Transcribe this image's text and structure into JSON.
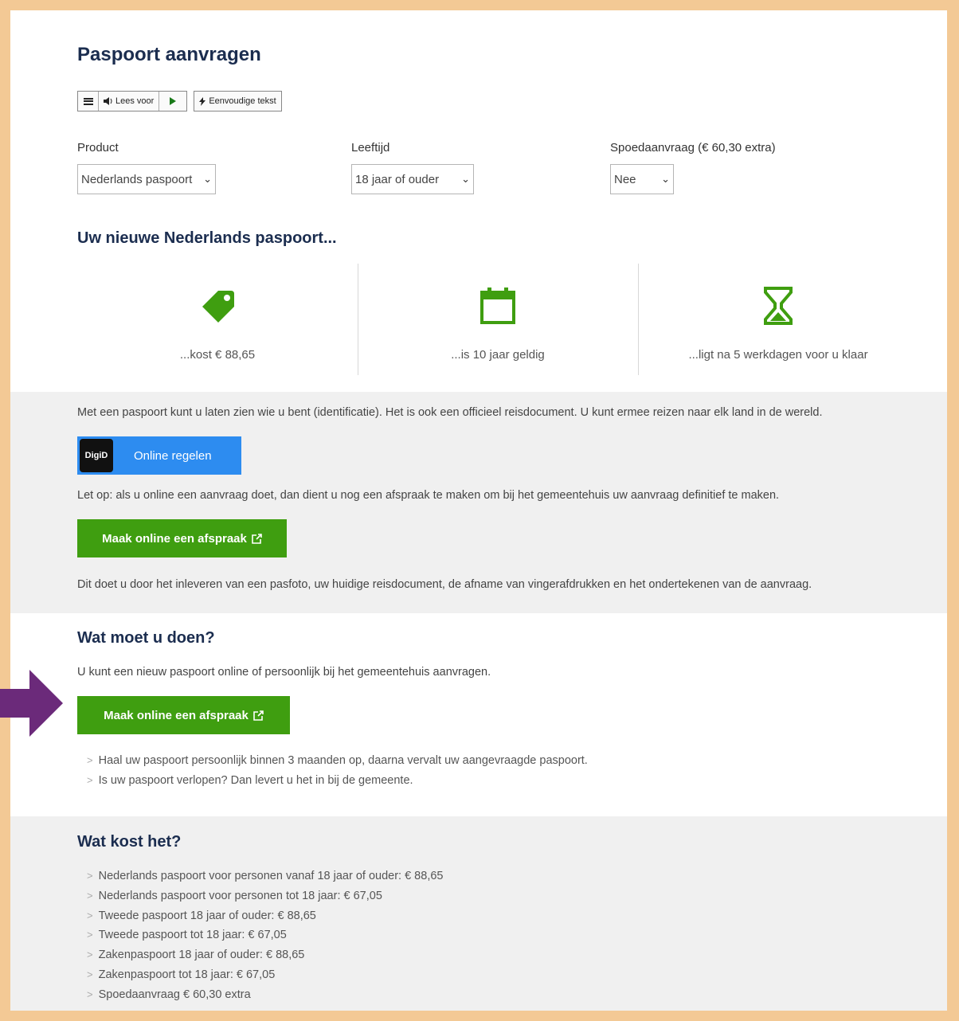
{
  "page": {
    "title": "Paspoort aanvragen"
  },
  "readspeaker": {
    "read_label": "Lees voor",
    "simple_text_label": "Eenvoudige tekst"
  },
  "filters": {
    "product": {
      "label": "Product",
      "value": "Nederlands paspoort"
    },
    "age": {
      "label": "Leeftijd",
      "value": "18 jaar of ouder"
    },
    "rush": {
      "label": "Spoedaanvraag (€ 60,30 extra)",
      "value": "Nee"
    }
  },
  "summary": {
    "heading": "Uw nieuwe Nederlands paspoort...",
    "features": [
      {
        "icon": "price-tag-icon",
        "text": "...kost € 88,65"
      },
      {
        "icon": "calendar-icon",
        "text": "...is 10 jaar geldig"
      },
      {
        "icon": "hourglass-icon",
        "text": "...ligt na 5 werkdagen voor u klaar"
      }
    ]
  },
  "intro": {
    "text": "Met een paspoort kunt u laten zien wie u bent (identificatie). Het is ook een officieel reisdocument. U kunt ermee reizen naar elk land in de wereld.",
    "digid_logo_text": "DigiD",
    "digid_button": "Online regelen",
    "notice": "Let op: als u online een aanvraag doet, dan dient u nog een afspraak te maken om bij het gemeentehuis uw aanvraag definitief te maken.",
    "appointment_button": "Maak online een afspraak",
    "details": "Dit doet u door het inleveren van een pasfoto, uw huidige reisdocument, de afname van vingerafdrukken en het ondertekenen van de aanvraag."
  },
  "todo": {
    "heading": "Wat moet u doen?",
    "text": "U kunt een nieuw paspoort online of persoonlijk bij het gemeentehuis aanvragen.",
    "appointment_button": "Maak online een afspraak",
    "items": [
      "Haal uw paspoort persoonlijk binnen 3 maanden op, daarna vervalt uw aangevraagde paspoort.",
      "Is uw paspoort verlopen? Dan levert u het in bij de gemeente."
    ]
  },
  "costs": {
    "heading": "Wat kost het?",
    "items": [
      "Nederlands paspoort voor personen vanaf 18 jaar of ouder: € 88,65",
      "Nederlands paspoort voor personen tot 18 jaar: € 67,05",
      "Tweede paspoort 18 jaar of ouder: € 88,65",
      "Tweede paspoort tot 18 jaar: € 67,05",
      "Zakenpaspoort 18 jaar of ouder: € 88,65",
      "Zakenpaspoort tot 18 jaar: € 67,05",
      "Spoedaanvraag € 60,30 extra"
    ]
  },
  "colors": {
    "frame": "#f3c995",
    "heading": "#1b2d4f",
    "green": "#3f9e10",
    "digid_blue": "#2d8cf0",
    "arrow": "#6b2a7a"
  }
}
